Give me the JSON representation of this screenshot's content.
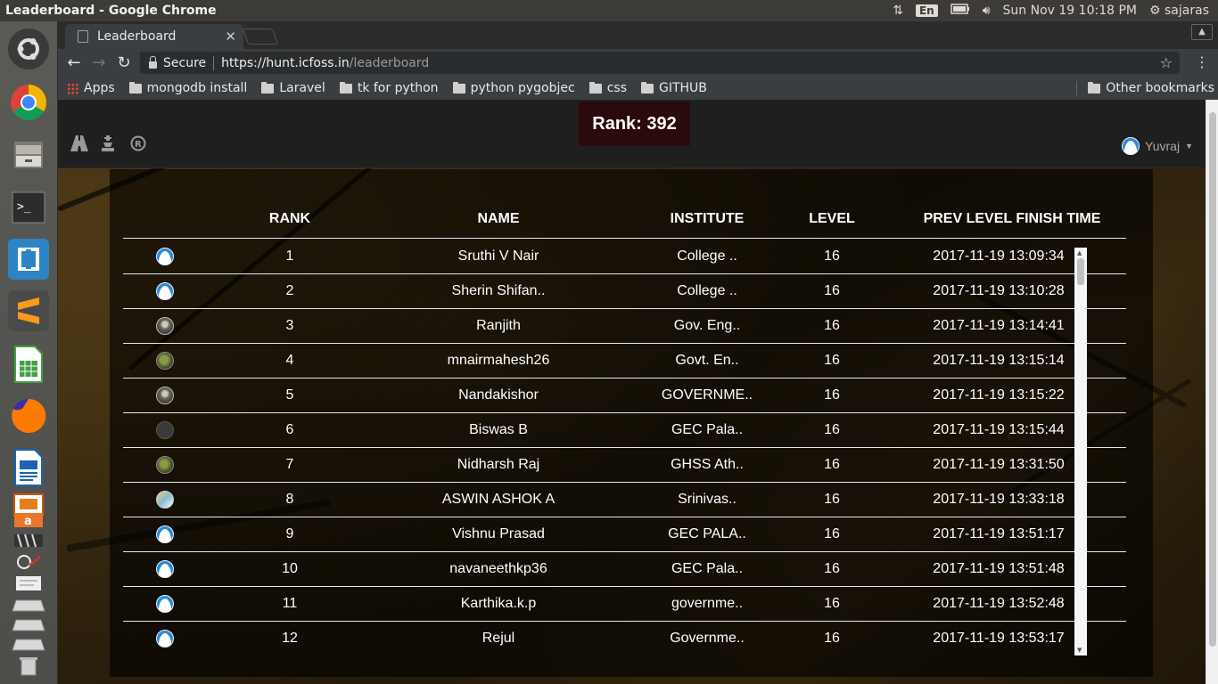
{
  "system": {
    "window_title": "Leaderboard - Google Chrome",
    "keyboard_layout": "En",
    "datetime": "Sun Nov 19 10:18 PM",
    "username": "sajaras"
  },
  "browser": {
    "tab_title": "Leaderboard",
    "security_label": "Secure",
    "url_host": "https://hunt.icfoss.in",
    "url_path": "/leaderboard",
    "bookmarks": [
      "Apps",
      "mongodb install",
      "Laravel",
      "tk for python",
      "python pygobjec",
      "css",
      "GITHUB"
    ],
    "other_bookmarks": "Other bookmarks"
  },
  "page": {
    "rank_label": "Rank: 392",
    "user_name": "Yuvraj",
    "columns": [
      "RANK",
      "NAME",
      "INSTITUTE",
      "LEVEL",
      "PREV LEVEL FINISH TIME"
    ],
    "rows": [
      {
        "avatar": "default-avatar",
        "rank": "1",
        "name": "Sruthi V Nair",
        "institute": "College ..",
        "level": "16",
        "time": "2017-11-19 13:09:34"
      },
      {
        "avatar": "default-avatar",
        "rank": "2",
        "name": "Sherin Shifan..",
        "institute": "College ..",
        "level": "16",
        "time": "2017-11-19 13:10:28"
      },
      {
        "avatar": "photo-avatar",
        "rank": "3",
        "name": "Ranjith",
        "institute": "Gov. Eng..",
        "level": "16",
        "time": "2017-11-19 13:14:41"
      },
      {
        "avatar": "photo-avatar-green",
        "rank": "4",
        "name": "mnairmahesh26",
        "institute": "Govt. En..",
        "level": "16",
        "time": "2017-11-19 13:15:14"
      },
      {
        "avatar": "photo-avatar",
        "rank": "5",
        "name": "Nandakishor",
        "institute": "GOVERNME..",
        "level": "16",
        "time": "2017-11-19 13:15:22"
      },
      {
        "avatar": "photo-avatar-dark",
        "rank": "6",
        "name": "Biswas B",
        "institute": "GEC Pala..",
        "level": "16",
        "time": "2017-11-19 13:15:44"
      },
      {
        "avatar": "photo-avatar-green",
        "rank": "7",
        "name": "Nidharsh Raj",
        "institute": "GHSS Ath..",
        "level": "16",
        "time": "2017-11-19 13:31:50"
      },
      {
        "avatar": "photo-avatar-mixed",
        "rank": "8",
        "name": "ASWIN ASHOK A",
        "institute": "Srinivas..",
        "level": "16",
        "time": "2017-11-19 13:33:18"
      },
      {
        "avatar": "default-avatar",
        "rank": "9",
        "name": "Vishnu Prasad",
        "institute": "GEC PALA..",
        "level": "16",
        "time": "2017-11-19 13:51:17"
      },
      {
        "avatar": "default-avatar",
        "rank": "10",
        "name": "navaneethkp36",
        "institute": "GEC Pala..",
        "level": "16",
        "time": "2017-11-19 13:51:48"
      },
      {
        "avatar": "default-avatar",
        "rank": "11",
        "name": "Karthika.k.p",
        "institute": "governme..",
        "level": "16",
        "time": "2017-11-19 13:52:48"
      },
      {
        "avatar": "default-avatar",
        "rank": "12",
        "name": "Rejul",
        "institute": "Governme..",
        "level": "16",
        "time": "2017-11-19 13:53:17"
      }
    ]
  },
  "colors": {
    "rank_box_bg": "#2a0a0a",
    "nav_bg": "#1f1f1f",
    "default_avatar": "#2b8ad8"
  }
}
